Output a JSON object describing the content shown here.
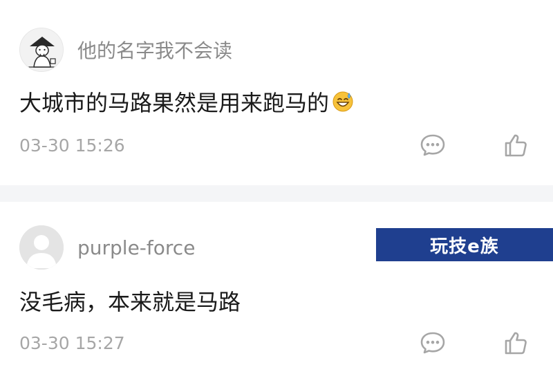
{
  "comments": [
    {
      "username": "他的名字我不会读",
      "content": "大城市的马路果然是用来跑马的",
      "emoji": "sweat-smile-emoji",
      "timestamp": "03-30 15:26",
      "avatar": "straw-hat-figure-avatar"
    },
    {
      "username": "purple-force",
      "content": "没毛病，本来就是马路",
      "timestamp": "03-30 15:27",
      "avatar": "default-person-avatar"
    }
  ],
  "watermark": {
    "text": "玩技e族",
    "background": "#1f3f8f"
  },
  "colors": {
    "username": "#8a8a8a",
    "content": "#1a1a1a",
    "timestamp": "#a6a6a6",
    "icon": "#a6a6a6",
    "separator": "#f4f5f7"
  }
}
